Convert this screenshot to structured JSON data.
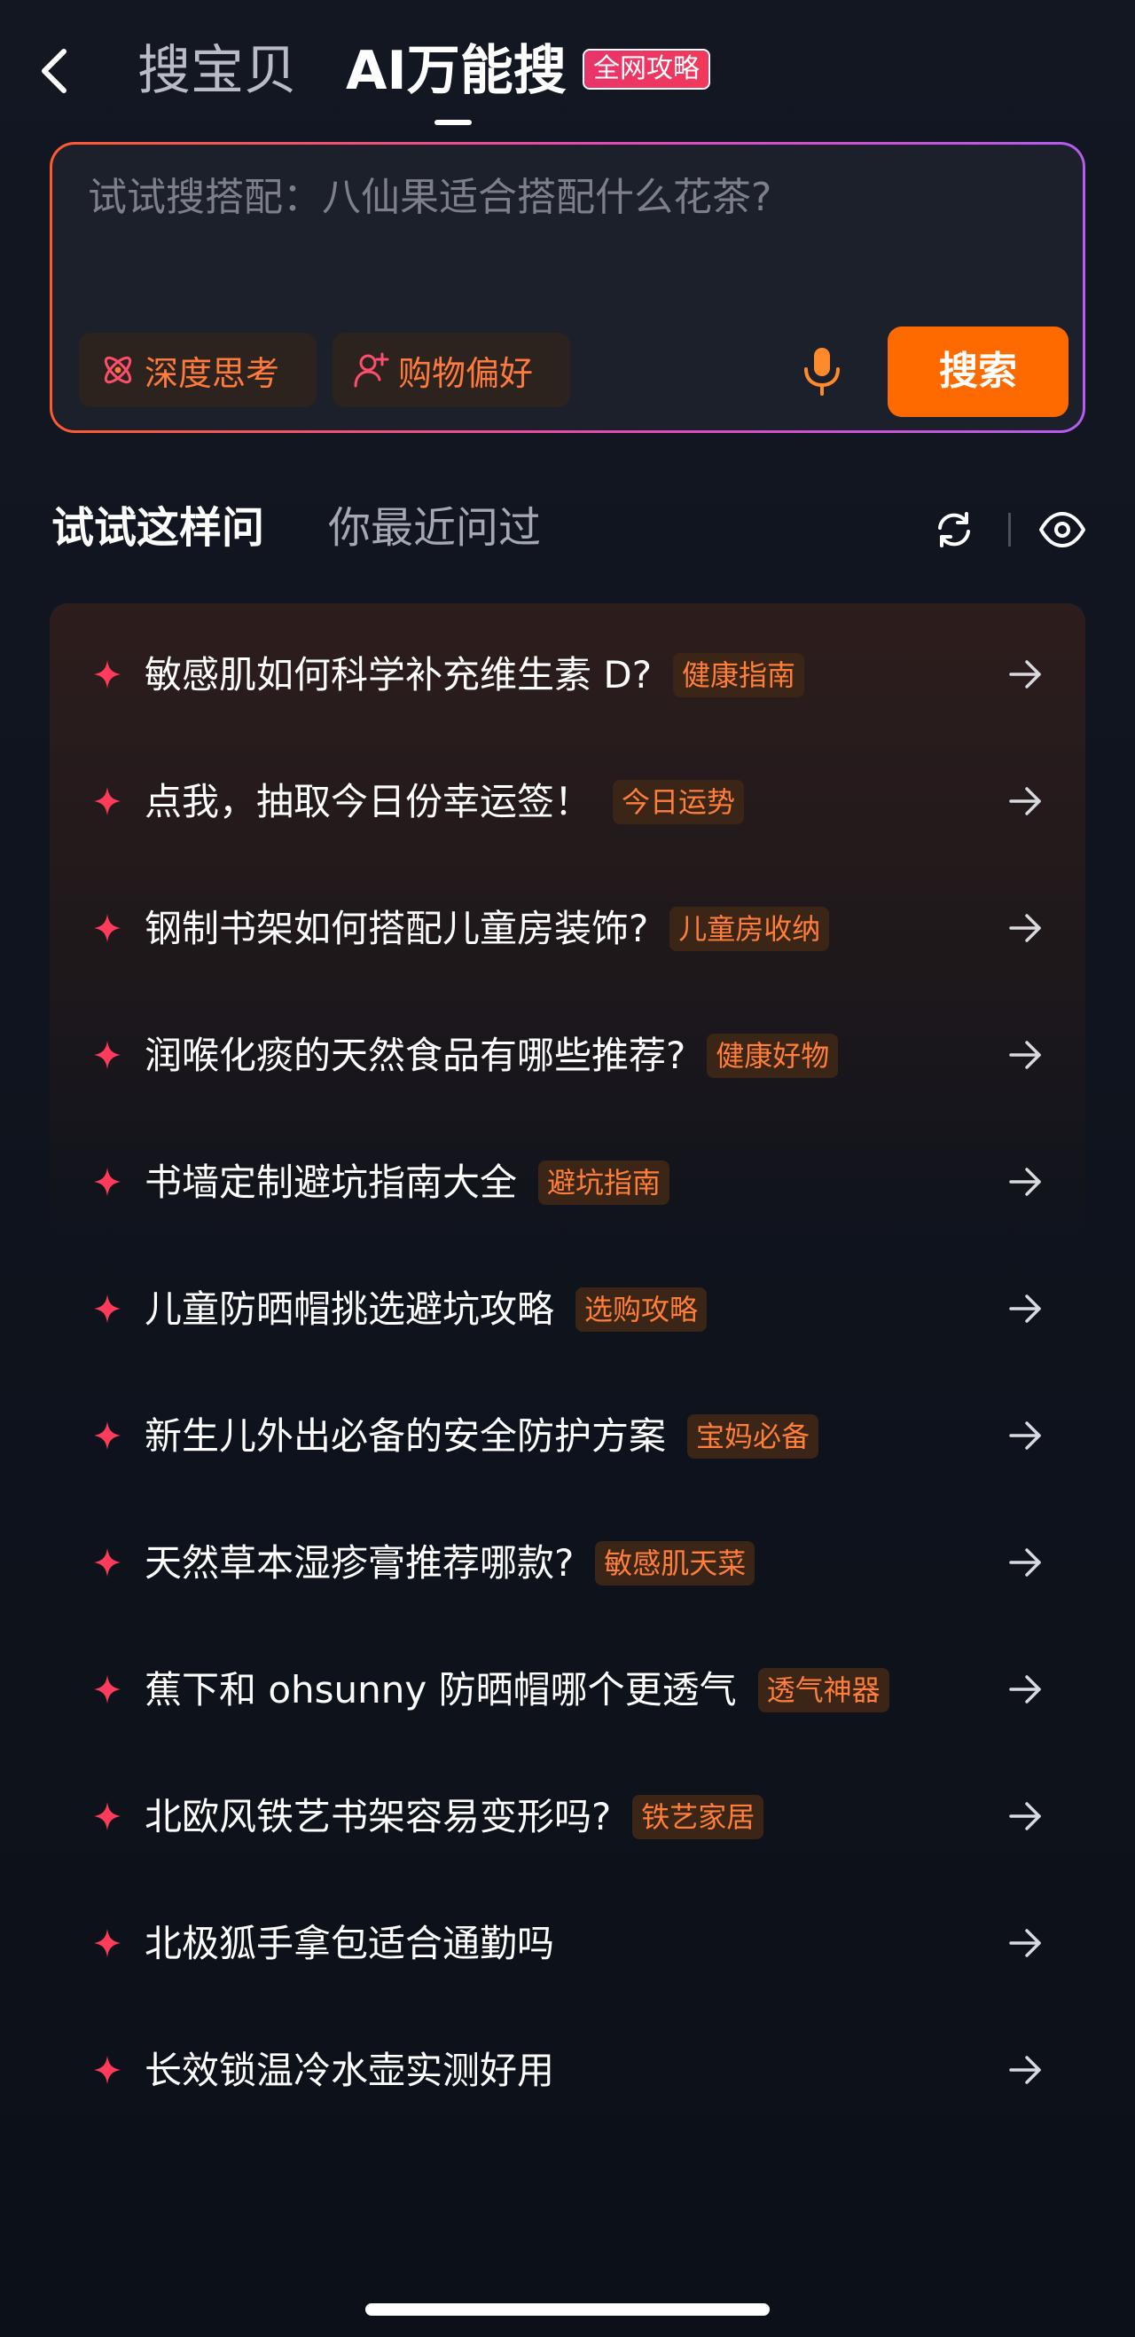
{
  "header": {
    "tab_items": "搜宝贝",
    "tab_ai": "AI万能搜",
    "badge": "全网攻略"
  },
  "search": {
    "placeholder": "试试搜搭配：八仙果适合搭配什么花茶?",
    "chip_deep": "深度思考",
    "chip_pref": "购物偏好",
    "button": "搜索"
  },
  "section": {
    "tab_try": "试试这样问",
    "tab_recent": "你最近问过"
  },
  "suggestions": [
    {
      "text": "敏感肌如何科学补充维生素 D?",
      "tag": "健康指南"
    },
    {
      "text": "点我，抽取今日份幸运签！",
      "tag": "今日运势"
    },
    {
      "text": "钢制书架如何搭配儿童房装饰?",
      "tag": "儿童房收纳"
    },
    {
      "text": "润喉化痰的天然食品有哪些推荐?",
      "tag": "健康好物"
    },
    {
      "text": "书墙定制避坑指南大全",
      "tag": "避坑指南"
    },
    {
      "text": "儿童防晒帽挑选避坑攻略",
      "tag": "选购攻略"
    },
    {
      "text": "新生儿外出必备的安全防护方案",
      "tag": "宝妈必备"
    },
    {
      "text": "天然草本湿疹膏推荐哪款?",
      "tag": "敏感肌天菜"
    },
    {
      "text": "蕉下和 ohsunny 防晒帽哪个更透气",
      "tag": "透气神器"
    },
    {
      "text": "北欧风铁艺书架容易变形吗?",
      "tag": "铁艺家居"
    },
    {
      "text": "北极狐手拿包适合通勤吗",
      "tag": ""
    },
    {
      "text": "长效锁温冷水壶实测好用",
      "tag": ""
    }
  ],
  "colors": {
    "accent": "#ff6a00",
    "tag_text": "#ff7e3a",
    "star": "#ff3b5c",
    "background": "#10141e"
  },
  "icons": {
    "back": "chevron-left-icon",
    "deep_think": "atom-icon",
    "shopping_pref": "user-heart-icon",
    "mic": "microphone-icon",
    "refresh": "refresh-icon",
    "visibility": "eye-icon",
    "bullet": "sparkle-star-icon",
    "row_action": "arrow-right-icon"
  }
}
